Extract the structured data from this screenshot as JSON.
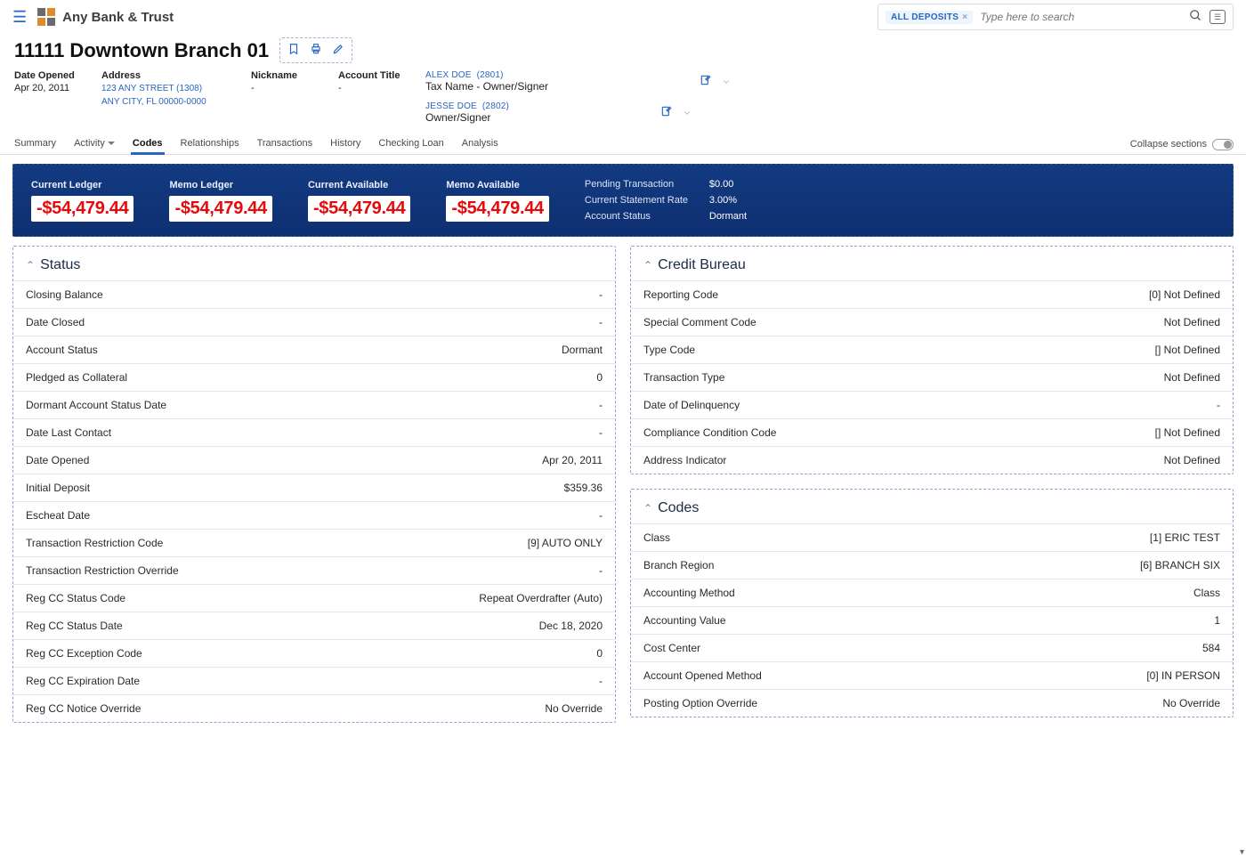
{
  "brand": "Any Bank & Trust",
  "search": {
    "chip": "ALL DEPOSITS",
    "placeholder": "Type here to search"
  },
  "page_title": "11111 Downtown Branch 01",
  "meta": {
    "date_opened": {
      "label": "Date Opened",
      "value": "Apr 20, 2011"
    },
    "address": {
      "label": "Address",
      "line1": "123 ANY STREET (1308)",
      "line2": "ANY CITY, FL 00000-0000"
    },
    "nickname": {
      "label": "Nickname",
      "value": "-"
    },
    "account_title": {
      "label": "Account Title",
      "value": "-"
    }
  },
  "signers": [
    {
      "name": "ALEX DOE",
      "id": "(2801)",
      "role": "Tax Name - Owner/Signer"
    },
    {
      "name": "JESSE DOE",
      "id": "(2802)",
      "role": "Owner/Signer"
    }
  ],
  "tabs": [
    "Summary",
    "Activity",
    "Codes",
    "Relationships",
    "Transactions",
    "History",
    "Checking Loan",
    "Analysis"
  ],
  "tabs_active": "Codes",
  "collapse_label": "Collapse sections",
  "banner": {
    "metrics": [
      {
        "label": "Current Ledger",
        "value": "-$54,479.44"
      },
      {
        "label": "Memo Ledger",
        "value": "-$54,479.44"
      },
      {
        "label": "Current Available",
        "value": "-$54,479.44"
      },
      {
        "label": "Memo Available",
        "value": "-$54,479.44"
      }
    ],
    "right": [
      {
        "label": "Pending Transaction",
        "value": "$0.00"
      },
      {
        "label": "Current Statement Rate",
        "value": "3.00%"
      },
      {
        "label": "Account Status",
        "value": "Dormant"
      }
    ]
  },
  "panels": {
    "status": {
      "title": "Status",
      "rows": [
        {
          "l": "Closing Balance",
          "v": "-"
        },
        {
          "l": "Date Closed",
          "v": "-"
        },
        {
          "l": "Account Status",
          "v": "Dormant"
        },
        {
          "l": "Pledged as Collateral",
          "v": "0"
        },
        {
          "l": "Dormant Account Status Date",
          "v": "-"
        },
        {
          "l": "Date Last Contact",
          "v": "-"
        },
        {
          "l": "Date Opened",
          "v": "Apr 20, 2011"
        },
        {
          "l": "Initial Deposit",
          "v": "$359.36"
        },
        {
          "l": "Escheat Date",
          "v": "-"
        },
        {
          "l": "Transaction Restriction Code",
          "v": "[9] AUTO ONLY"
        },
        {
          "l": "Transaction Restriction Override",
          "v": "-"
        },
        {
          "l": "Reg CC Status Code",
          "v": "Repeat Overdrafter (Auto)"
        },
        {
          "l": "Reg CC Status Date",
          "v": "Dec 18, 2020"
        },
        {
          "l": "Reg CC Exception Code",
          "v": "0"
        },
        {
          "l": "Reg CC Expiration Date",
          "v": "-"
        },
        {
          "l": "Reg CC Notice Override",
          "v": "No Override"
        }
      ]
    },
    "credit": {
      "title": "Credit Bureau",
      "rows": [
        {
          "l": "Reporting Code",
          "v": "[0] Not Defined"
        },
        {
          "l": "Special Comment Code",
          "v": "Not Defined"
        },
        {
          "l": "Type Code",
          "v": "[] Not Defined"
        },
        {
          "l": "Transaction Type",
          "v": "Not Defined"
        },
        {
          "l": "Date of Delinquency",
          "v": "-"
        },
        {
          "l": "Compliance Condition Code",
          "v": "[] Not Defined"
        },
        {
          "l": "Address Indicator",
          "v": "Not Defined"
        }
      ]
    },
    "codes": {
      "title": "Codes",
      "rows": [
        {
          "l": "Class",
          "v": "[1] ERIC TEST"
        },
        {
          "l": "Branch Region",
          "v": "[6] BRANCH SIX"
        },
        {
          "l": "Accounting Method",
          "v": "Class"
        },
        {
          "l": "Accounting Value",
          "v": "1"
        },
        {
          "l": "Cost Center",
          "v": "584"
        },
        {
          "l": "Account Opened Method",
          "v": "[0] IN PERSON"
        },
        {
          "l": "Posting Option Override",
          "v": "No Override"
        }
      ]
    }
  }
}
